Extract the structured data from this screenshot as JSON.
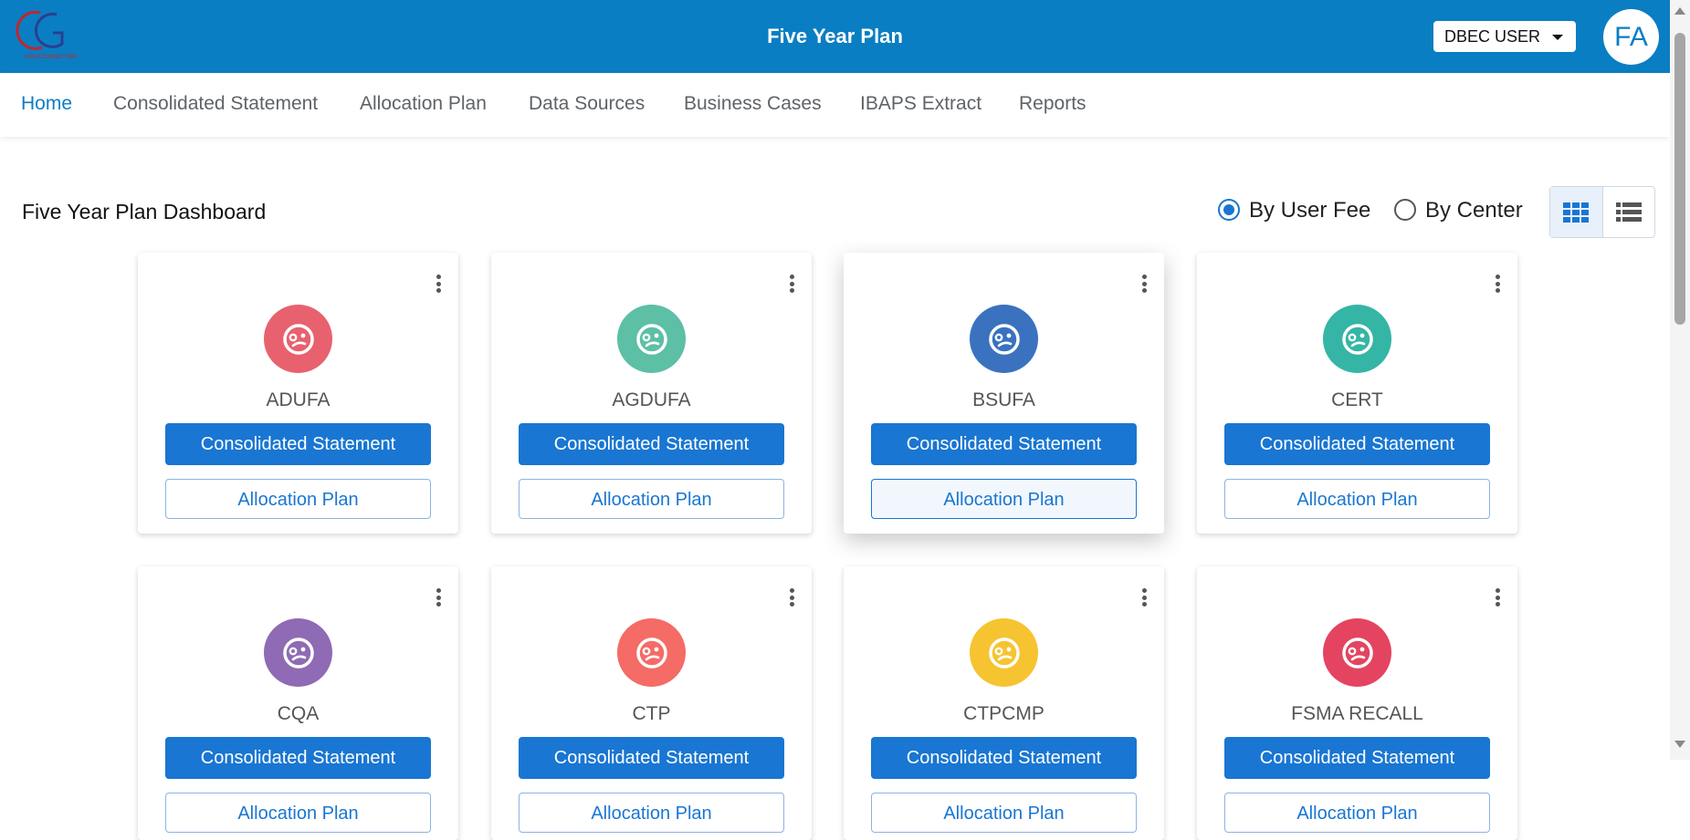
{
  "header": {
    "logo_text": "GOVCONNECT360",
    "title": "Five Year Plan",
    "user_select": {
      "value": "DBEC USER",
      "icon": "caret-down-icon"
    },
    "avatar_initials": "FA",
    "colors": {
      "bar": "#0a7ec2"
    }
  },
  "nav": {
    "items": [
      {
        "label": "Home",
        "active": true
      },
      {
        "label": "Consolidated Statement",
        "active": false
      },
      {
        "label": "Allocation Plan",
        "active": false
      },
      {
        "label": "Data Sources",
        "active": false
      },
      {
        "label": "Business Cases",
        "active": false
      },
      {
        "label": "IBAPS Extract",
        "active": false
      },
      {
        "label": "Reports",
        "active": false
      }
    ]
  },
  "dashboard": {
    "title": "Five Year Plan Dashboard",
    "filters": [
      {
        "label": "By User Fee",
        "checked": true
      },
      {
        "label": "By Center",
        "checked": false
      }
    ],
    "view_toggle": {
      "grid_icon": "grid-view-icon",
      "list_icon": "list-view-icon",
      "selected": "grid"
    }
  },
  "cards": [
    {
      "name": "ADUFA",
      "color": "#e8616f",
      "primary": "Consolidated Statement",
      "secondary": "Allocation Plan"
    },
    {
      "name": "AGDUFA",
      "color": "#5cbfa6",
      "primary": "Consolidated Statement",
      "secondary": "Allocation Plan"
    },
    {
      "name": "BSUFA",
      "color": "#3a72c0",
      "primary": "Consolidated Statement",
      "secondary": "Allocation Plan"
    },
    {
      "name": "CERT",
      "color": "#35b5a5",
      "primary": "Consolidated Statement",
      "secondary": "Allocation Plan"
    },
    {
      "name": "CQA",
      "color": "#8e6bb4",
      "primary": "Consolidated Statement",
      "secondary": "Allocation Plan"
    },
    {
      "name": "CTP",
      "color": "#f56b66",
      "primary": "Consolidated Statement",
      "secondary": "Allocation Plan"
    },
    {
      "name": "CTPCMP",
      "color": "#f6c431",
      "primary": "Consolidated Statement",
      "secondary": "Allocation Plan"
    },
    {
      "name": "FSMA RECALL",
      "color": "#e44460",
      "primary": "Consolidated Statement",
      "secondary": "Allocation Plan"
    }
  ],
  "card_icon": "chart-face-icon",
  "card_menu_icon": "more-vert-icon"
}
